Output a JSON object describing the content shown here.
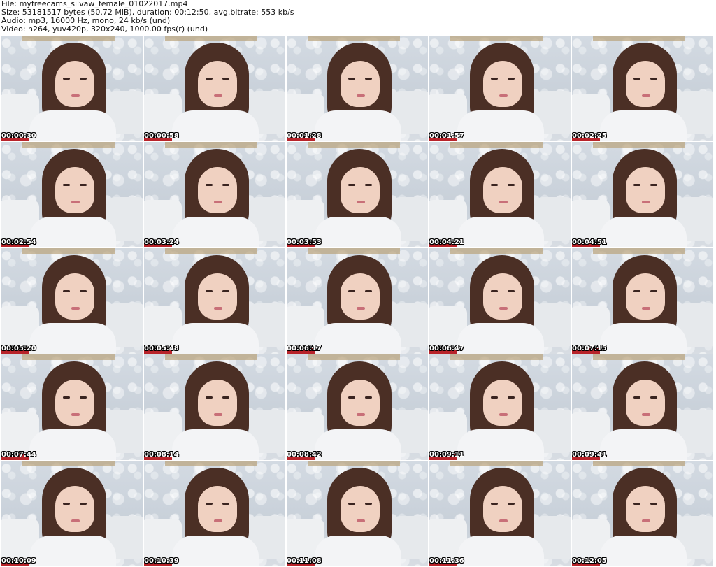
{
  "header": {
    "file_line": "File: myfreecams_silvaw_female_01022017.mp4",
    "size_line": "Size: 53181517 bytes (50.72 MiB), duration: 00:12:50, avg.bitrate: 553 kb/s",
    "audio_line": "Audio: mp3, 16000 Hz, mono, 24 kb/s (und)",
    "video_line": "Video: h264, yuv420p, 320x240, 1000.00 fps(r) (und)"
  },
  "thumbnails": [
    {
      "timestamp": "00:00:30"
    },
    {
      "timestamp": "00:00:58"
    },
    {
      "timestamp": "00:01:28"
    },
    {
      "timestamp": "00:01:57"
    },
    {
      "timestamp": "00:02:25"
    },
    {
      "timestamp": "00:02:54"
    },
    {
      "timestamp": "00:03:24"
    },
    {
      "timestamp": "00:03:53"
    },
    {
      "timestamp": "00:04:21"
    },
    {
      "timestamp": "00:04:51"
    },
    {
      "timestamp": "00:05:20"
    },
    {
      "timestamp": "00:05:48"
    },
    {
      "timestamp": "00:06:17"
    },
    {
      "timestamp": "00:06:47"
    },
    {
      "timestamp": "00:07:15"
    },
    {
      "timestamp": "00:07:44"
    },
    {
      "timestamp": "00:08:14"
    },
    {
      "timestamp": "00:08:42"
    },
    {
      "timestamp": "00:09:11"
    },
    {
      "timestamp": "00:09:41"
    },
    {
      "timestamp": "00:10:09"
    },
    {
      "timestamp": "00:10:39"
    },
    {
      "timestamp": "00:11:08"
    },
    {
      "timestamp": "00:11:36"
    },
    {
      "timestamp": "00:12:05"
    }
  ]
}
